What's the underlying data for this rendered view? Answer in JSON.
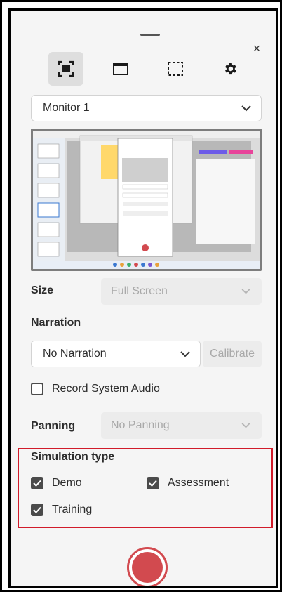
{
  "close_label": "×",
  "toolbar": {
    "items": [
      {
        "icon": "fullscreen-capture-icon",
        "active": true
      },
      {
        "icon": "window-capture-icon",
        "active": false
      },
      {
        "icon": "region-capture-icon",
        "active": false
      },
      {
        "icon": "gear-icon",
        "active": false
      }
    ]
  },
  "monitor": {
    "selected": "Monitor 1"
  },
  "size": {
    "label": "Size",
    "value": "Full Screen"
  },
  "narration": {
    "label": "Narration",
    "value": "No Narration",
    "calibrate_label": "Calibrate"
  },
  "record_system_audio": {
    "label": "Record System Audio",
    "checked": false
  },
  "panning": {
    "label": "Panning",
    "value": "No Panning"
  },
  "simulation": {
    "title": "Simulation type",
    "options": [
      {
        "label": "Demo",
        "checked": true
      },
      {
        "label": "Assessment",
        "checked": true
      },
      {
        "label": "Training",
        "checked": true
      }
    ]
  },
  "colors": {
    "accent_red": "#d24a4f",
    "highlight_border": "#d11b2a"
  }
}
